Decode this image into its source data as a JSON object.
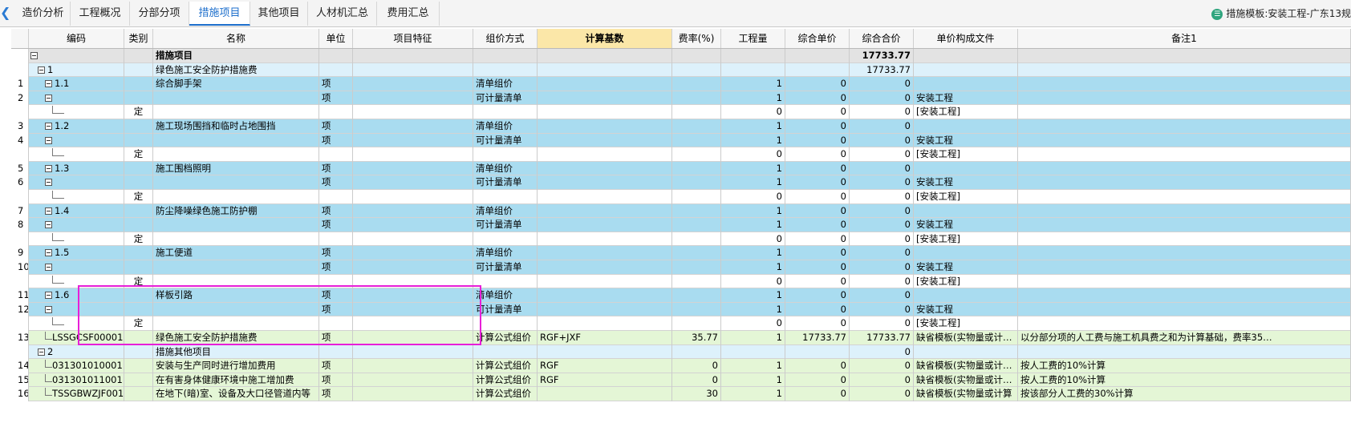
{
  "tabs": [
    "造价分析",
    "工程概况",
    "分部分项",
    "措施项目",
    "其他项目",
    "人材机汇总",
    "费用汇总"
  ],
  "active_tab": "措施项目",
  "template_label": "措施模板:安装工程-广东13规",
  "columns": [
    "编码",
    "类别",
    "名称",
    "单位",
    "项目特征",
    "组价方式",
    "计算基数",
    "费率(%)",
    "工程量",
    "综合单价",
    "综合合价",
    "单价构成文件",
    "备注1"
  ],
  "colors": {
    "blue_row": "#a9dcf0",
    "light_blue_row": "#ddf1fb",
    "green_row": "#e4f6d6",
    "summary_row": "#e3e3e3",
    "highlight_header": "#fbe7a8",
    "selection_box": "#e71fd8",
    "accent": "#1e6fcc"
  },
  "rows": [
    {
      "num": "",
      "code": "",
      "type": "",
      "name": "措施项目",
      "unit": "",
      "feature": "",
      "method": "",
      "base": "",
      "rate": "",
      "qty": "",
      "price": "",
      "total": "17733.77",
      "file": "",
      "note": "",
      "style": "summary",
      "indent": 0,
      "tog": true
    },
    {
      "num": "",
      "code": "1",
      "type": "",
      "name": "绿色施工安全防护措施费",
      "unit": "",
      "feature": "",
      "method": "",
      "base": "",
      "rate": "",
      "qty": "",
      "price": "",
      "total": "17733.77",
      "file": "",
      "note": "",
      "style": "light",
      "indent": 1,
      "tog": true
    },
    {
      "num": "1",
      "code": "1.1",
      "type": "",
      "name": "综合脚手架",
      "unit": "项",
      "feature": "",
      "method": "清单组价",
      "base": "",
      "rate": "",
      "qty": "1",
      "price": "0",
      "total": "0",
      "file": "",
      "note": "",
      "style": "blue",
      "indent": 2,
      "tog": true
    },
    {
      "num": "2",
      "code": "",
      "type": "",
      "name": "",
      "unit": "项",
      "feature": "",
      "method": "可计量清单",
      "base": "",
      "rate": "",
      "qty": "1",
      "price": "0",
      "total": "0",
      "file": "安装工程",
      "note": "",
      "style": "blue",
      "indent": 2,
      "tog": true
    },
    {
      "num": "",
      "code": "",
      "type": "定",
      "name": "",
      "unit": "",
      "feature": "",
      "method": "",
      "base": "",
      "rate": "",
      "qty": "0",
      "price": "0",
      "total": "0",
      "file": "[安装工程]",
      "note": "",
      "style": "white",
      "indent": 3,
      "tog": false
    },
    {
      "num": "3",
      "code": "1.2",
      "type": "",
      "name": "施工现场围挡和临时占地围挡",
      "unit": "项",
      "feature": "",
      "method": "清单组价",
      "base": "",
      "rate": "",
      "qty": "1",
      "price": "0",
      "total": "0",
      "file": "",
      "note": "",
      "style": "blue",
      "indent": 2,
      "tog": true
    },
    {
      "num": "4",
      "code": "",
      "type": "",
      "name": "",
      "unit": "项",
      "feature": "",
      "method": "可计量清单",
      "base": "",
      "rate": "",
      "qty": "1",
      "price": "0",
      "total": "0",
      "file": "安装工程",
      "note": "",
      "style": "blue",
      "indent": 2,
      "tog": true
    },
    {
      "num": "",
      "code": "",
      "type": "定",
      "name": "",
      "unit": "",
      "feature": "",
      "method": "",
      "base": "",
      "rate": "",
      "qty": "0",
      "price": "0",
      "total": "0",
      "file": "[安装工程]",
      "note": "",
      "style": "white",
      "indent": 3,
      "tog": false
    },
    {
      "num": "5",
      "code": "1.3",
      "type": "",
      "name": "施工围档照明",
      "unit": "项",
      "feature": "",
      "method": "清单组价",
      "base": "",
      "rate": "",
      "qty": "1",
      "price": "0",
      "total": "0",
      "file": "",
      "note": "",
      "style": "blue",
      "indent": 2,
      "tog": true
    },
    {
      "num": "6",
      "code": "",
      "type": "",
      "name": "",
      "unit": "项",
      "feature": "",
      "method": "可计量清单",
      "base": "",
      "rate": "",
      "qty": "1",
      "price": "0",
      "total": "0",
      "file": "安装工程",
      "note": "",
      "style": "blue",
      "indent": 2,
      "tog": true
    },
    {
      "num": "",
      "code": "",
      "type": "定",
      "name": "",
      "unit": "",
      "feature": "",
      "method": "",
      "base": "",
      "rate": "",
      "qty": "0",
      "price": "0",
      "total": "0",
      "file": "[安装工程]",
      "note": "",
      "style": "white",
      "indent": 3,
      "tog": false
    },
    {
      "num": "7",
      "code": "1.4",
      "type": "",
      "name": "防尘降噪绿色施工防护棚",
      "unit": "项",
      "feature": "",
      "method": "清单组价",
      "base": "",
      "rate": "",
      "qty": "1",
      "price": "0",
      "total": "0",
      "file": "",
      "note": "",
      "style": "blue",
      "indent": 2,
      "tog": true
    },
    {
      "num": "8",
      "code": "",
      "type": "",
      "name": "",
      "unit": "项",
      "feature": "",
      "method": "可计量清单",
      "base": "",
      "rate": "",
      "qty": "1",
      "price": "0",
      "total": "0",
      "file": "安装工程",
      "note": "",
      "style": "blue",
      "indent": 2,
      "tog": true
    },
    {
      "num": "",
      "code": "",
      "type": "定",
      "name": "",
      "unit": "",
      "feature": "",
      "method": "",
      "base": "",
      "rate": "",
      "qty": "0",
      "price": "0",
      "total": "0",
      "file": "[安装工程]",
      "note": "",
      "style": "white",
      "indent": 3,
      "tog": false
    },
    {
      "num": "9",
      "code": "1.5",
      "type": "",
      "name": "施工便道",
      "unit": "项",
      "feature": "",
      "method": "清单组价",
      "base": "",
      "rate": "",
      "qty": "1",
      "price": "0",
      "total": "0",
      "file": "",
      "note": "",
      "style": "blue",
      "indent": 2,
      "tog": true
    },
    {
      "num": "10",
      "code": "",
      "type": "",
      "name": "",
      "unit": "项",
      "feature": "",
      "method": "可计量清单",
      "base": "",
      "rate": "",
      "qty": "1",
      "price": "0",
      "total": "0",
      "file": "安装工程",
      "note": "",
      "style": "blue",
      "indent": 2,
      "tog": true
    },
    {
      "num": "",
      "code": "",
      "type": "定",
      "name": "",
      "unit": "",
      "feature": "",
      "method": "",
      "base": "",
      "rate": "",
      "qty": "0",
      "price": "0",
      "total": "0",
      "file": "[安装工程]",
      "note": "",
      "style": "white",
      "indent": 3,
      "tog": false
    },
    {
      "num": "11",
      "code": "1.6",
      "type": "",
      "name": "样板引路",
      "unit": "项",
      "feature": "",
      "method": "清单组价",
      "base": "",
      "rate": "",
      "qty": "1",
      "price": "0",
      "total": "0",
      "file": "",
      "note": "",
      "style": "blue",
      "indent": 2,
      "tog": true
    },
    {
      "num": "12",
      "code": "",
      "type": "",
      "name": "",
      "unit": "项",
      "feature": "",
      "method": "可计量清单",
      "base": "",
      "rate": "",
      "qty": "1",
      "price": "0",
      "total": "0",
      "file": "安装工程",
      "note": "",
      "style": "blue",
      "indent": 2,
      "tog": true
    },
    {
      "num": "",
      "code": "",
      "type": "定",
      "name": "",
      "unit": "",
      "feature": "",
      "method": "",
      "base": "",
      "rate": "",
      "qty": "0",
      "price": "0",
      "total": "0",
      "file": "[安装工程]",
      "note": "",
      "style": "white",
      "indent": 3,
      "tog": false
    },
    {
      "num": "13",
      "code": "LSSGCSF00001",
      "type": "",
      "name": "绿色施工安全防护措施费",
      "unit": "项",
      "feature": "",
      "method": "计算公式组价",
      "base": "RGF+JXF",
      "rate": "35.77",
      "qty": "1",
      "price": "17733.77",
      "total": "17733.77",
      "file": "缺省模板(实物量或计…",
      "note": "以分部分项的人工费与施工机具费之和为计算基础，费率35…",
      "style": "green",
      "indent": 2,
      "tog": false
    },
    {
      "num": "",
      "code": "2",
      "type": "",
      "name": "措施其他项目",
      "unit": "",
      "feature": "",
      "method": "",
      "base": "",
      "rate": "",
      "qty": "",
      "price": "",
      "total": "0",
      "file": "",
      "note": "",
      "style": "light",
      "indent": 1,
      "tog": true
    },
    {
      "num": "14",
      "code": "031301010001",
      "type": "",
      "name": "安装与生产同时进行增加费用",
      "unit": "项",
      "feature": "",
      "method": "计算公式组价",
      "base": "RGF",
      "rate": "0",
      "qty": "1",
      "price": "0",
      "total": "0",
      "file": "缺省模板(实物量或计…",
      "note": "按人工费的10%计算",
      "style": "green",
      "indent": 2,
      "tog": false
    },
    {
      "num": "15",
      "code": "031301011001",
      "type": "",
      "name": "在有害身体健康环境中施工增加费",
      "unit": "项",
      "feature": "",
      "method": "计算公式组价",
      "base": "RGF",
      "rate": "0",
      "qty": "1",
      "price": "0",
      "total": "0",
      "file": "缺省模板(实物量或计…",
      "note": "按人工费的10%计算",
      "style": "green",
      "indent": 2,
      "tog": false
    },
    {
      "num": "16",
      "code": "TSSGBWZJF001",
      "type": "",
      "name": "在地下(暗)室、设备及大口径管道内等",
      "unit": "项",
      "feature": "",
      "method": "计算公式组价",
      "base": "",
      "rate": "30",
      "qty": "1",
      "price": "0",
      "total": "0",
      "file": "缺省模板(实物量或计算",
      "note": "按该部分人工费的30%计算",
      "style": "green",
      "indent": 2,
      "tog": false
    }
  ]
}
